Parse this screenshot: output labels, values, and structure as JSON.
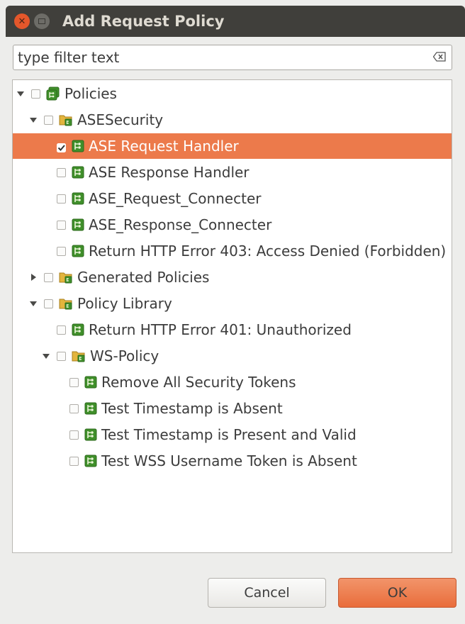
{
  "window": {
    "title": "Add Request Policy"
  },
  "filter": {
    "value": "type filter text",
    "clear_icon": "clear-text-icon"
  },
  "tree": {
    "rows": [
      {
        "label": "Policies",
        "level": 0,
        "expandable": true,
        "expanded": true,
        "icon": "policy-folder-icon",
        "checked": false,
        "selected": false
      },
      {
        "label": "ASESecurity",
        "level": 1,
        "expandable": true,
        "expanded": true,
        "icon": "folder-icon",
        "checked": false,
        "selected": false
      },
      {
        "label": "ASE Request Handler",
        "level": 2,
        "expandable": false,
        "icon": "policy-icon",
        "checked": true,
        "selected": true
      },
      {
        "label": "ASE Response Handler",
        "level": 2,
        "expandable": false,
        "icon": "policy-icon",
        "checked": false,
        "selected": false
      },
      {
        "label": "ASE_Request_Connecter",
        "level": 2,
        "expandable": false,
        "icon": "policy-icon",
        "checked": false,
        "selected": false
      },
      {
        "label": "ASE_Response_Connecter",
        "level": 2,
        "expandable": false,
        "icon": "policy-icon",
        "checked": false,
        "selected": false
      },
      {
        "label": "Return HTTP Error 403: Access Denied (Forbidden)",
        "level": 2,
        "expandable": false,
        "icon": "policy-icon",
        "checked": false,
        "selected": false
      },
      {
        "label": "Generated Policies",
        "level": 1,
        "expandable": true,
        "expanded": false,
        "icon": "folder-icon",
        "checked": false,
        "selected": false
      },
      {
        "label": "Policy Library",
        "level": 1,
        "expandable": true,
        "expanded": true,
        "icon": "folder-icon",
        "checked": false,
        "selected": false
      },
      {
        "label": "Return HTTP Error 401: Unauthorized",
        "level": 2,
        "expandable": false,
        "icon": "policy-icon",
        "checked": false,
        "selected": false
      },
      {
        "label": "WS-Policy",
        "level": 2,
        "expandable": true,
        "expanded": true,
        "icon": "folder-icon",
        "checked": false,
        "selected": false
      },
      {
        "label": "Remove All Security Tokens",
        "level": 3,
        "expandable": false,
        "icon": "policy-icon",
        "checked": false,
        "selected": false
      },
      {
        "label": "Test Timestamp is Absent",
        "level": 3,
        "expandable": false,
        "icon": "policy-icon",
        "checked": false,
        "selected": false
      },
      {
        "label": "Test Timestamp is Present and Valid",
        "level": 3,
        "expandable": false,
        "icon": "policy-icon",
        "checked": false,
        "selected": false
      },
      {
        "label": "Test WSS Username Token is Absent",
        "level": 3,
        "expandable": false,
        "icon": "policy-icon",
        "checked": false,
        "selected": false
      }
    ]
  },
  "buttons": {
    "cancel": "Cancel",
    "ok": "OK"
  },
  "colors": {
    "selection": "#ec7a4b",
    "titlebar": "#403f3b",
    "close": "#e4572b",
    "policy_green": "#3f8f2a",
    "folder_yellow": "#e3b53d"
  }
}
